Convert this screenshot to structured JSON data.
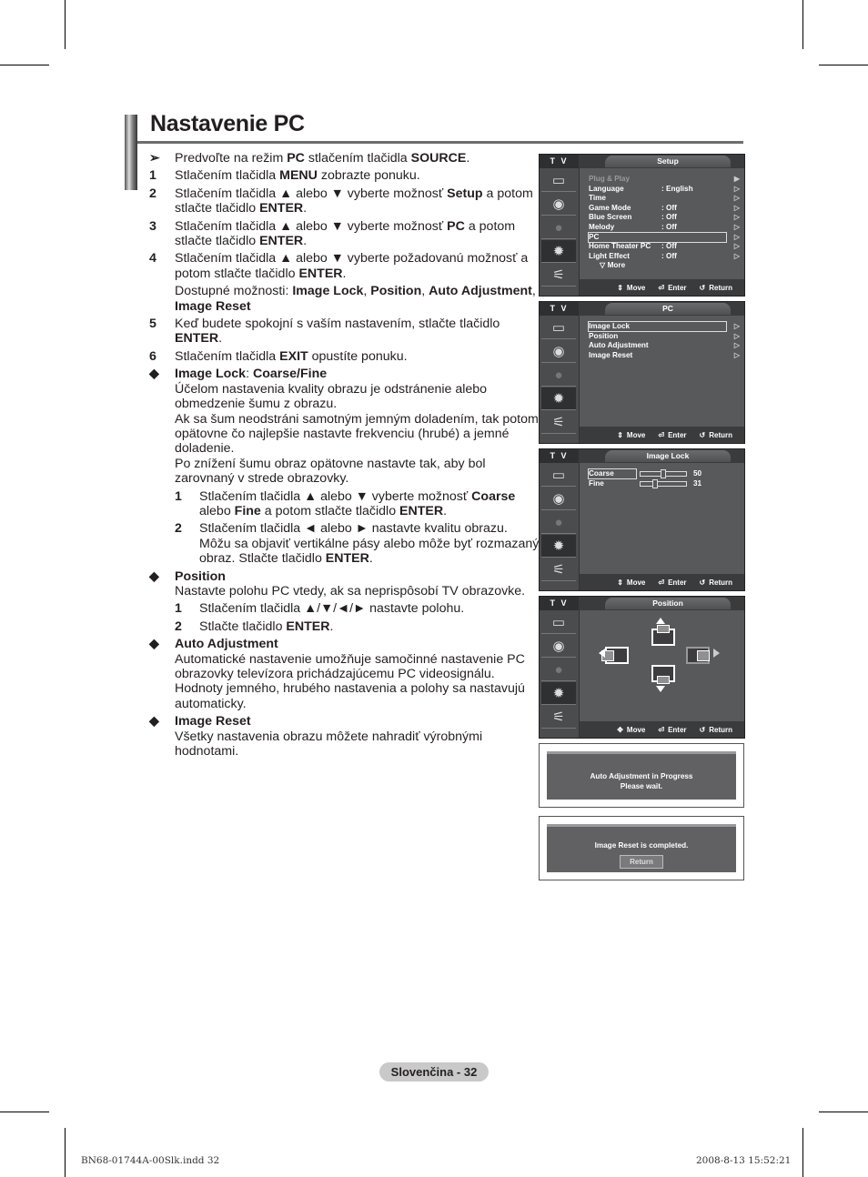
{
  "page": {
    "title": "Nastavenie PC",
    "footer_badge": "Slovenčina - 32",
    "slug_left": "BN68-01744A-00Slk.indd   32",
    "slug_right": "2008-8-13   15:52:21"
  },
  "instructions": {
    "note_marker": "➢",
    "note": [
      "Predvoľte na režim ",
      "PC",
      " stlačením tlačidla ",
      "SOURCE",
      "."
    ],
    "steps": [
      {
        "num": "1",
        "parts": [
          "Stlačením tlačidla ",
          "MENU",
          " zobrazte ponuku."
        ]
      },
      {
        "num": "2",
        "parts": [
          "Stlačením tlačidla ▲ alebo ▼ vyberte možnosť ",
          "Setup",
          " a potom stlačte tlačidlo ",
          "ENTER",
          "."
        ]
      },
      {
        "num": "3",
        "parts": [
          "Stlačením tlačidla ▲ alebo ▼ vyberte možnosť ",
          "PC",
          " a potom stlačte tlačidlo ",
          "ENTER",
          "."
        ]
      },
      {
        "num": "4",
        "parts": [
          "Stlačením tlačidla ▲ alebo ▼ vyberte požadovanú možnosť a potom stlačte tlačidlo ",
          "ENTER",
          "."
        ]
      },
      {
        "num": "",
        "parts": [
          "Dostupné možnosti: ",
          "Image Lock",
          ", ",
          "Position",
          ", ",
          "Auto Adjustment",
          ", ",
          "Image Reset",
          ""
        ]
      },
      {
        "num": "5",
        "parts": [
          "Keď budete spokojní s vaším nastavením, stlačte tlačidlo ",
          "ENTER",
          "."
        ]
      },
      {
        "num": "6",
        "parts": [
          "Stlačením tlačidla ",
          "EXIT",
          " opustíte ponuku."
        ]
      }
    ],
    "sections": [
      {
        "heading": [
          "Image Lock",
          ": ",
          "Coarse/Fine"
        ],
        "paragraphs": [
          "Účelom nastavenia kvality obrazu je odstránenie alebo obmedzenie šumu z obrazu.",
          "Ak sa šum neodstráni samotným jemným doladením, tak potom opätovne čo najlepšie nastavte frekvenciu (hrubé) a jemné doladenie.",
          "Po znížení šumu obraz opätovne nastavte tak, aby bol zarovnaný v strede obrazovky."
        ],
        "substeps": [
          {
            "num": "1",
            "parts": [
              "Stlačením tlačidla ▲ alebo ▼ vyberte možnosť ",
              "Coarse",
              " alebo ",
              "Fine",
              " a potom stlačte tlačidlo ",
              "ENTER",
              "."
            ]
          },
          {
            "num": "2",
            "parts": [
              "Stlačením tlačidla ◄ alebo ► nastavte kvalitu obrazu. Môžu sa objaviť vertikálne pásy alebo môže byť rozmazaný obraz. Stlačte tlačidlo ",
              "ENTER",
              "."
            ]
          }
        ]
      },
      {
        "heading": [
          "Position",
          "",
          ""
        ],
        "paragraphs": [
          "Nastavte polohu PC vtedy, ak sa neprispôsobí TV obrazovke."
        ],
        "substeps": [
          {
            "num": "1",
            "parts": [
              "Stlačením tlačidla ▲/▼/◄/► nastavte polohu.",
              "",
              ""
            ]
          },
          {
            "num": "2",
            "parts": [
              "Stlačte tlačidlo ",
              "ENTER",
              "."
            ]
          }
        ]
      },
      {
        "heading": [
          "Auto Adjustment",
          "",
          ""
        ],
        "paragraphs": [
          "Automatické nastavenie umožňuje samočinné nastavenie PC obrazovky televízora prichádzajúcemu PC videosignálu. Hodnoty jemného, hrubého nastavenia a polohy sa nastavujú automaticky."
        ],
        "substeps": []
      },
      {
        "heading": [
          "Image Reset",
          "",
          ""
        ],
        "paragraphs": [
          "Všetky nastavenia obrazu môžete nahradiť výrobnými hodnotami."
        ],
        "substeps": []
      }
    ],
    "bullet": "◆"
  },
  "osd": {
    "tv_label": "T V",
    "footer": {
      "move": "Move",
      "enter": "Enter",
      "return": "Return"
    },
    "screens": {
      "setup": {
        "title": "Setup",
        "items": [
          {
            "label": "Plug & Play",
            "value": "",
            "dim": true,
            "arrow": "▶"
          },
          {
            "label": "Language",
            "value": ": English",
            "arrow": "▷"
          },
          {
            "label": "Time",
            "value": "",
            "arrow": "▷"
          },
          {
            "label": "Game Mode",
            "value": ": Off",
            "arrow": "▷"
          },
          {
            "label": "Blue Screen",
            "value": ": Off",
            "arrow": "▷"
          },
          {
            "label": "Melody",
            "value": ": Off",
            "arrow": "▷"
          },
          {
            "label": "PC",
            "value": "",
            "arrow": "▷",
            "selected": true
          },
          {
            "label": "Home Theater PC",
            "value": ": Off",
            "arrow": "▷"
          },
          {
            "label": "Light Effect",
            "value": ": Off",
            "arrow": "▷"
          },
          {
            "label": "▽ More",
            "value": "",
            "arrow": ""
          }
        ]
      },
      "pc": {
        "title": "PC",
        "items": [
          {
            "label": "Image Lock",
            "arrow": "▷",
            "selected": true
          },
          {
            "label": "Position",
            "arrow": "▷"
          },
          {
            "label": "Auto Adjustment",
            "arrow": "▷"
          },
          {
            "label": "Image Reset",
            "arrow": "▷"
          }
        ]
      },
      "image_lock": {
        "title": "Image Lock",
        "sliders": [
          {
            "label": "Coarse",
            "value": 50,
            "fraction": 0.5,
            "selected": true
          },
          {
            "label": "Fine",
            "value": 31,
            "fraction": 0.31
          }
        ]
      },
      "position": {
        "title": "Position"
      }
    },
    "dialogs": {
      "auto_adjust": {
        "line1": "Auto Adjustment in Progress",
        "line2": "Please wait."
      },
      "image_reset": {
        "line1": "Image Reset is completed.",
        "button": "Return"
      }
    }
  }
}
